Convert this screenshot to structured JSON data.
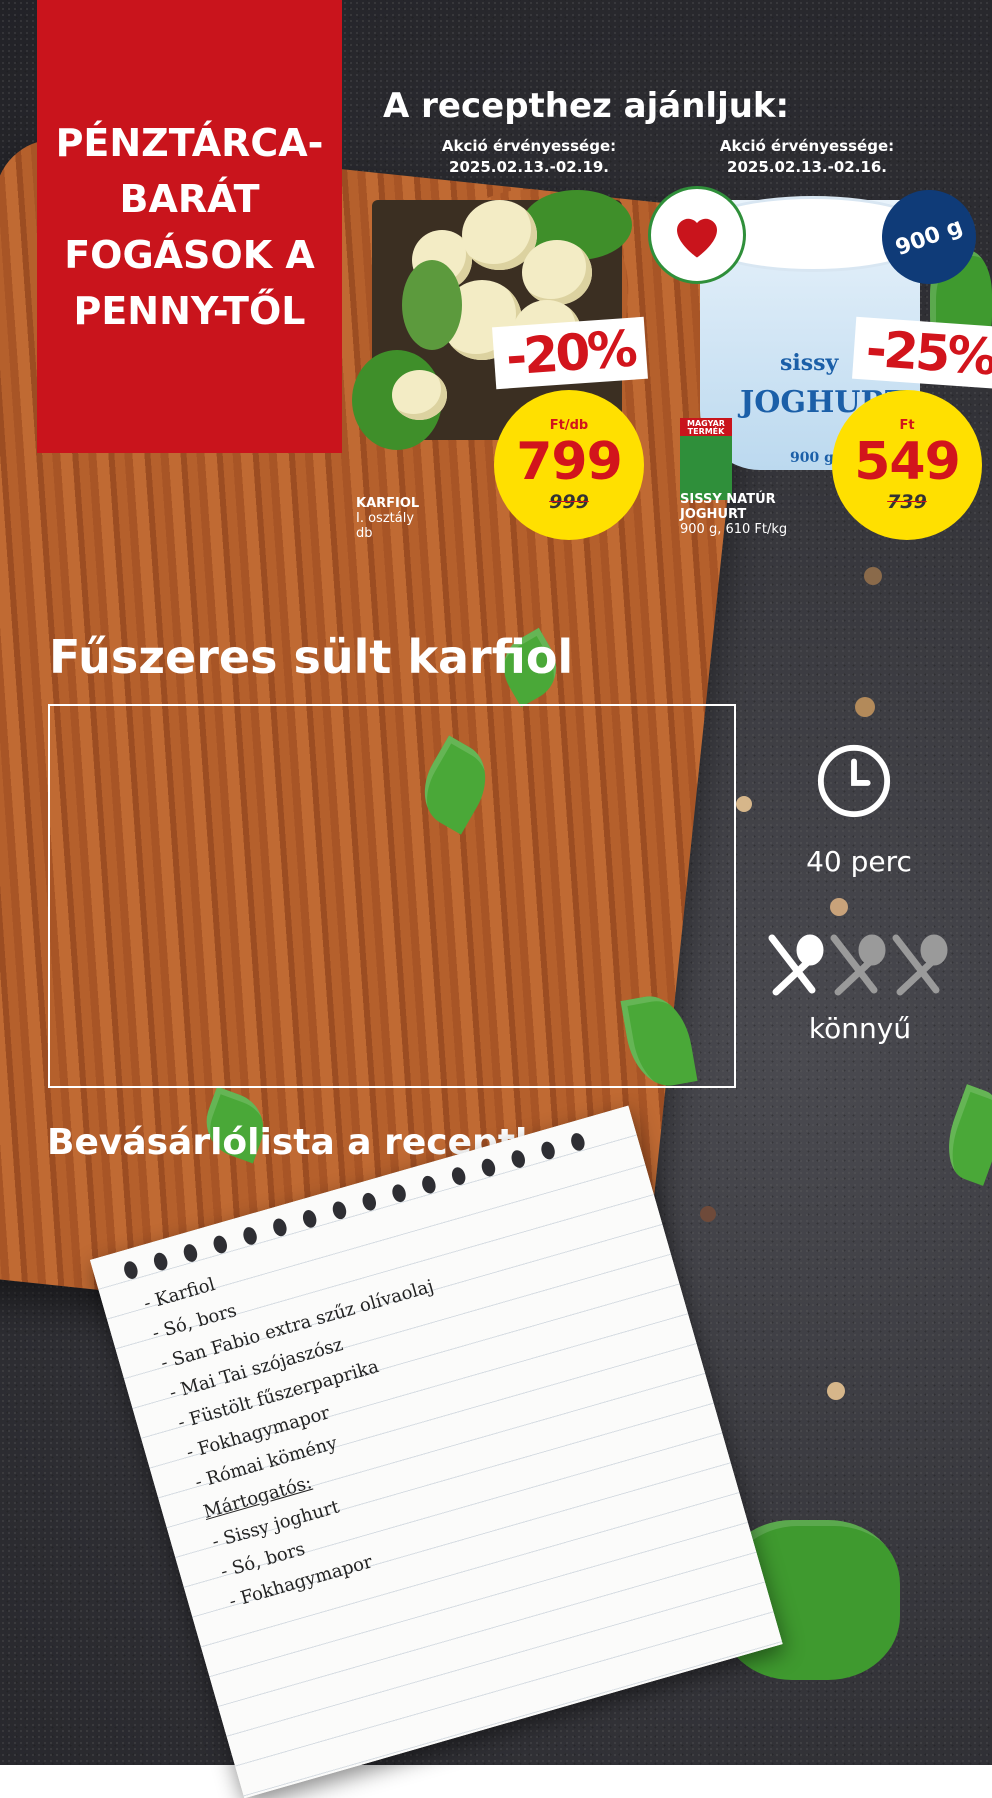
{
  "panel": {
    "title": "PÉNZTÁRCA-\nBARÁT\nFOGÁSOK A\nPENNY-TŐL"
  },
  "recommend": {
    "title": "A recepthez ajánljuk:"
  },
  "products": [
    {
      "validity_label": "Akció érvényessége:",
      "validity_dates": "2025.02.13.-02.19.",
      "discount": "-20%",
      "unit": "Ft/db",
      "price": "799",
      "old_price": "999",
      "name": "KARFIOL",
      "details": [
        "I. osztály",
        "db"
      ]
    },
    {
      "validity_label": "Akció érvényessége:",
      "validity_dates": "2025.02.13.-02.16.",
      "discount": "-25%",
      "unit": "Ft",
      "price": "549",
      "old_price": "739",
      "name": "SISSY NATÚR",
      "name2": "JOGHURT",
      "details": [
        "900 g, 610 Ft/kg"
      ],
      "weight_badge": "900 g",
      "brand": "sissy",
      "pack_text": "JOGHURT",
      "pack_weight": "900 g",
      "origin_badge": "MAGYAR TERMÉK",
      "heart_badge": "ITTHONRÓL VÁLOGATVA"
    }
  ],
  "recipe": {
    "title": "Fűszeres sült karfiol",
    "time": "40 perc",
    "difficulty": "könnyű",
    "difficulty_level": 1,
    "difficulty_max": 3
  },
  "shopping": {
    "title": "Bevásárlólista a recepthez:",
    "items": [
      "- Karfiol",
      "- Só, bors",
      "- San Fabio extra szűz olívaolaj",
      "- Mai Tai szójaszósz",
      "- Füstölt fűszerpaprika",
      "- Fokhagymapor",
      "- Római kömény",
      "Mártogatós:",
      "- Sissy joghurt",
      "- Só, bors",
      "- Fokhagymapor"
    ]
  },
  "colors": {
    "brand_red": "#c9141c",
    "price_yellow": "#ffe000",
    "accent_blue": "#0f3b78"
  },
  "icons": [
    "clock-icon",
    "spoon-fork-icon",
    "heart-badge-icon"
  ]
}
